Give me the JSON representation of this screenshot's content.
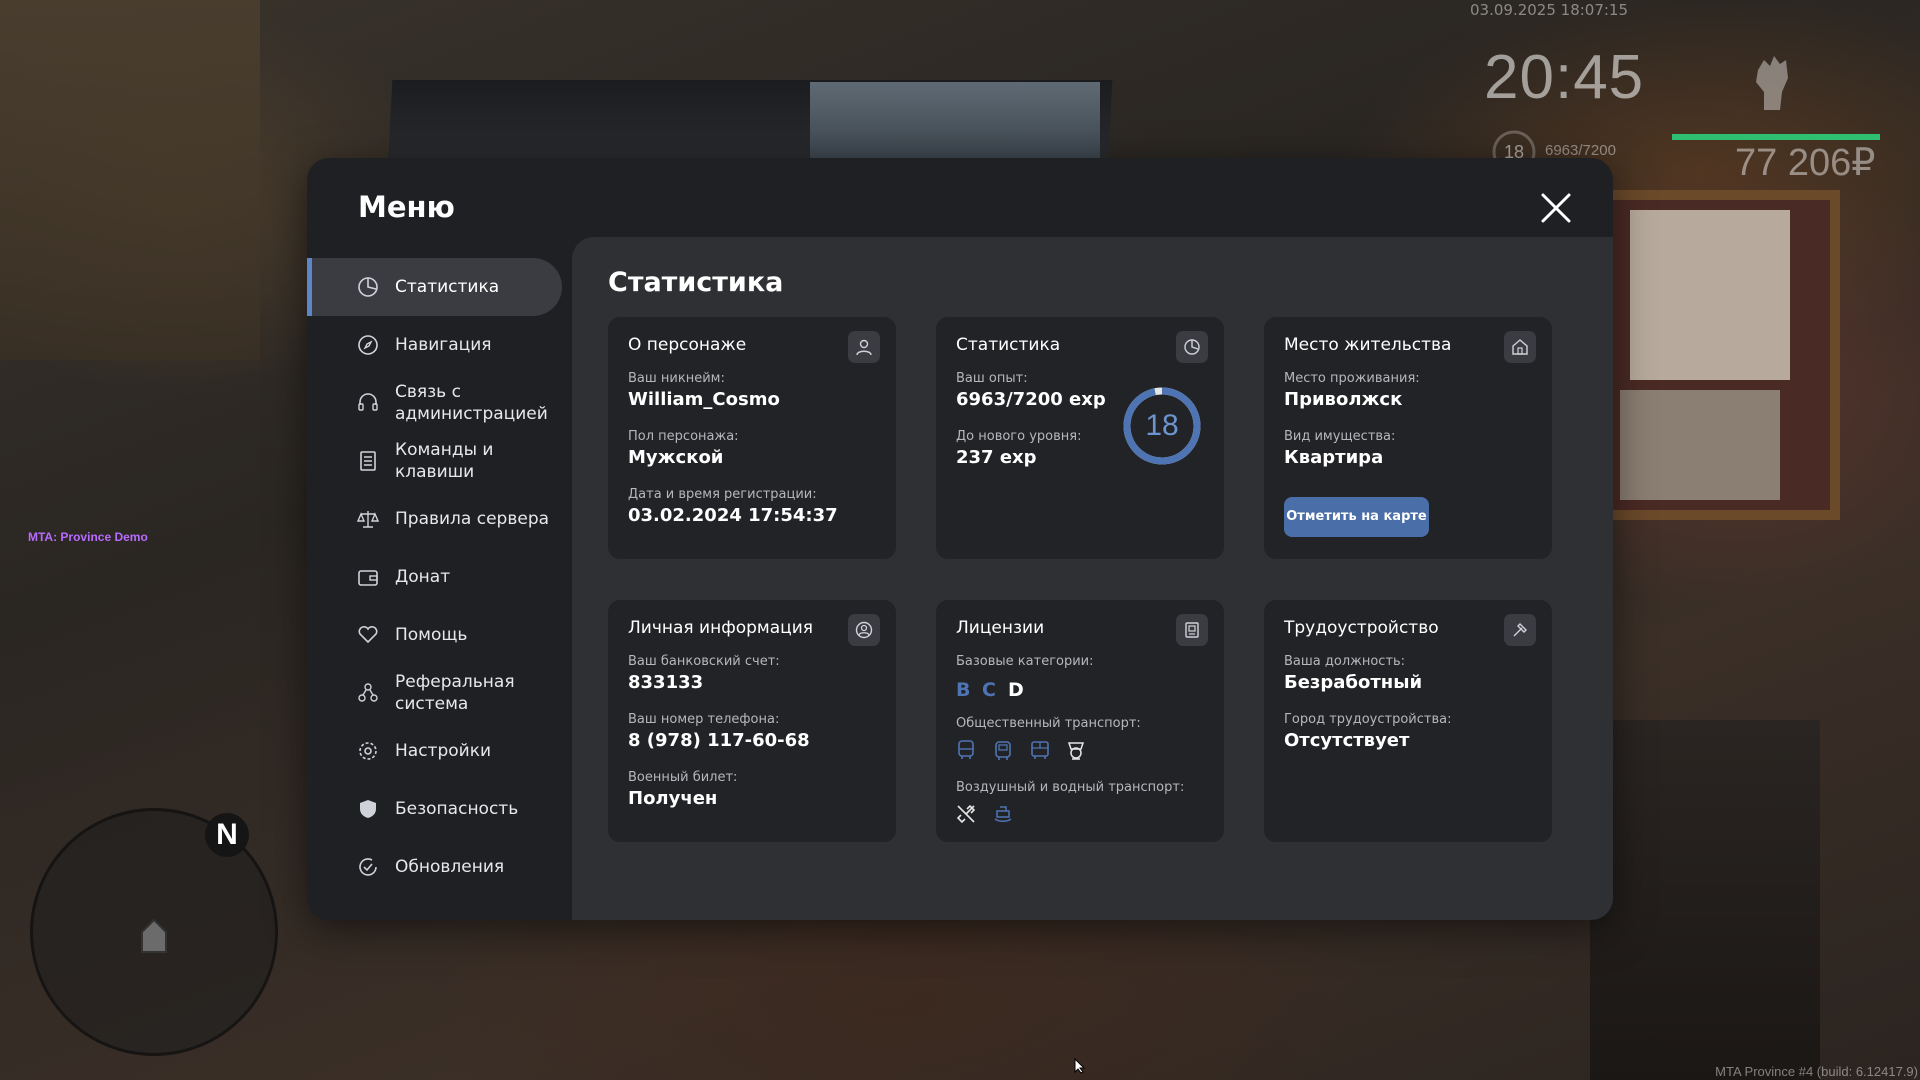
{
  "hud": {
    "datetime": "03.09.2025 18:07:15",
    "time": "20:45",
    "level": "18",
    "exp": "6963/7200",
    "money": "77 206₽",
    "server_tag": "MTA: Province Demo",
    "build": "MTA Province #4 (build: 6.12417.9)",
    "compass": "N"
  },
  "menu": {
    "title": "Меню",
    "sidebar": [
      {
        "label": "Статистика",
        "icon": "chart-pie-icon",
        "active": true
      },
      {
        "label": "Навигация",
        "icon": "compass-icon"
      },
      {
        "label": "Связь с администрацией",
        "icon": "headset-icon"
      },
      {
        "label": "Команды и клавиши",
        "icon": "document-list-icon"
      },
      {
        "label": "Правила сервера",
        "icon": "scales-icon"
      },
      {
        "label": "Донат",
        "icon": "wallet-icon"
      },
      {
        "label": "Помощь",
        "icon": "heart-hand-icon"
      },
      {
        "label": "Реферальная система",
        "icon": "people-network-icon"
      },
      {
        "label": "Настройки",
        "icon": "gear-icon"
      },
      {
        "label": "Безопасность",
        "icon": "shield-icon"
      },
      {
        "label": "Обновления",
        "icon": "refresh-check-icon"
      }
    ]
  },
  "content": {
    "title": "Статистика",
    "character": {
      "title": "О персонаже",
      "nickname_label": "Ваш никнейм:",
      "nickname": "William_Cosmo",
      "gender_label": "Пол персонажа:",
      "gender": "Мужской",
      "reg_label": "Дата и время регистрации:",
      "reg": "03.02.2024 17:54:37"
    },
    "stats": {
      "title": "Статистика",
      "exp_label": "Ваш опыт:",
      "exp": "6963/7200 exp",
      "next_label": "До нового уровня:",
      "next": "237 exp",
      "level": "18",
      "progress": 0.967
    },
    "residence": {
      "title": "Место жительства",
      "place_label": "Место проживания:",
      "place": "Приволжск",
      "property_label": "Вид имущества:",
      "property": "Квартира",
      "map_button": "Отметить на карте"
    },
    "personal": {
      "title": "Личная информация",
      "bank_label": "Ваш банковский счет:",
      "bank": "833133",
      "phone_label": "Ваш номер телефона:",
      "phone": "8 (978) 117-60-68",
      "military_label": "Военный билет:",
      "military": "Получен"
    },
    "licenses": {
      "title": "Лицензии",
      "basic_label": "Базовые категории:",
      "categories": [
        {
          "name": "B",
          "color": "#4f74b3"
        },
        {
          "name": "C",
          "color": "#4f74b3"
        },
        {
          "name": "D",
          "color": "#ffffff"
        }
      ],
      "public_label": "Общественный транспорт:",
      "air_water_label": "Воздушный и водный транспорт:"
    },
    "job": {
      "title": "Трудоустройство",
      "position_label": "Ваша должность:",
      "position": "Безработный",
      "city_label": "Город трудоустройства:",
      "city": "Отсутствует"
    }
  },
  "colors": {
    "accent": "#5b86c8",
    "button": "#4a6fa8",
    "card": "#222326",
    "panel": "#2f3034"
  }
}
